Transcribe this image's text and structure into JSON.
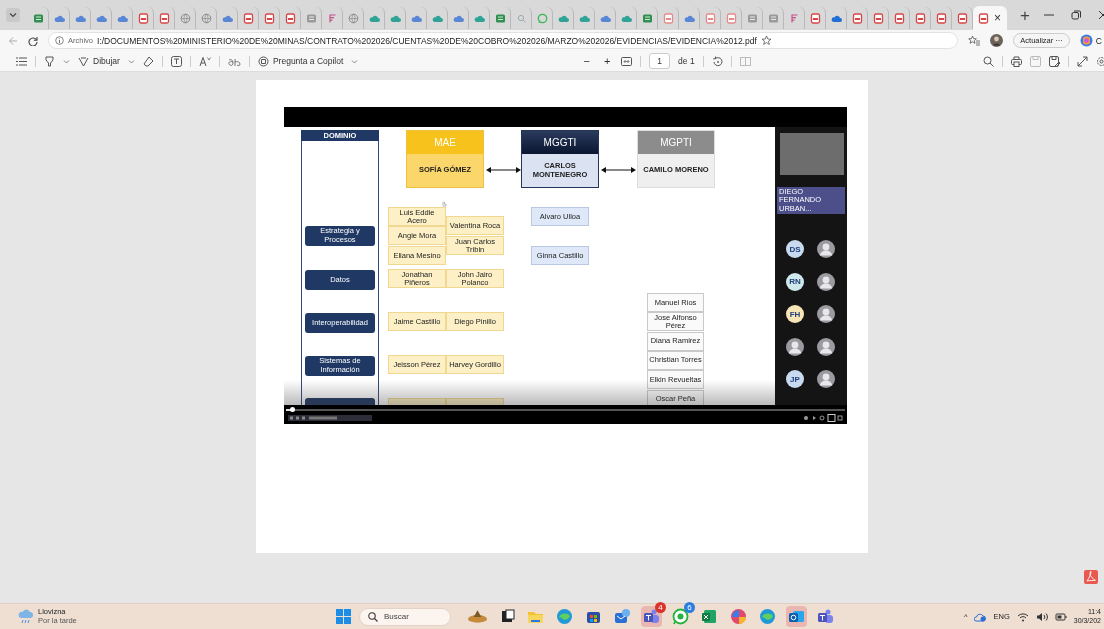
{
  "tab_strip": {
    "tabs": [
      {
        "kind": "sheet",
        "selected": false
      },
      {
        "kind": "cloud",
        "selected": false
      },
      {
        "kind": "cloud",
        "selected": false
      },
      {
        "kind": "cloud",
        "selected": false
      },
      {
        "kind": "cloud",
        "selected": false
      },
      {
        "kind": "pdf",
        "selected": false
      },
      {
        "kind": "pdf",
        "selected": false
      },
      {
        "kind": "globe",
        "selected": false
      },
      {
        "kind": "globe",
        "selected": false
      },
      {
        "kind": "cloud",
        "selected": false
      },
      {
        "kind": "pdf",
        "selected": false
      },
      {
        "kind": "pdf",
        "selected": false
      },
      {
        "kind": "pdf",
        "selected": false
      },
      {
        "kind": "leaf",
        "selected": false
      },
      {
        "kind": "flag",
        "selected": false
      },
      {
        "kind": "globe",
        "selected": false
      },
      {
        "kind": "teal",
        "selected": false
      },
      {
        "kind": "teal",
        "selected": false
      },
      {
        "kind": "cloud",
        "selected": false
      },
      {
        "kind": "teal",
        "selected": false
      },
      {
        "kind": "cloud",
        "selected": false
      },
      {
        "kind": "teal",
        "selected": false
      },
      {
        "kind": "sheet",
        "selected": false
      },
      {
        "kind": "search",
        "selected": false
      },
      {
        "kind": "chat",
        "selected": false
      },
      {
        "kind": "teal",
        "selected": false
      },
      {
        "kind": "teal",
        "selected": false
      },
      {
        "kind": "cloud",
        "selected": false
      },
      {
        "kind": "teal",
        "selected": false
      },
      {
        "kind": "sheet",
        "selected": false
      },
      {
        "kind": "doc",
        "selected": false
      },
      {
        "kind": "cloud",
        "selected": false
      },
      {
        "kind": "doc",
        "selected": false
      },
      {
        "kind": "doc",
        "selected": false
      },
      {
        "kind": "leaf",
        "selected": false
      },
      {
        "kind": "leaf",
        "selected": false
      },
      {
        "kind": "flag",
        "selected": false
      },
      {
        "kind": "pdf",
        "selected": false
      },
      {
        "kind": "onedrive",
        "selected": false
      },
      {
        "kind": "pdf",
        "selected": false
      },
      {
        "kind": "pdf",
        "selected": false
      },
      {
        "kind": "pdf",
        "selected": false
      },
      {
        "kind": "pdf",
        "selected": false
      },
      {
        "kind": "pdf",
        "selected": false
      },
      {
        "kind": "pdf",
        "selected": false
      },
      {
        "kind": "pdf",
        "selected": true
      }
    ],
    "close": "×",
    "new_tab": "+"
  },
  "address_bar": {
    "site_info": "Archivo",
    "url": "I:/DOCUMENTOS%20MINISTERIO%20DE%20MINAS/CONTRATO%202026/CUENTAS%20DE%20COBRO%202026/MARZO%202026/EVIDENCIAS/EVIDENCIA%2012.pdf",
    "update_button": "Actualizar ···",
    "copilot_label": "C"
  },
  "pdf_toolbar": {
    "draw_label": "Dibujar",
    "copilot_prompt": "Pregunta a Copilot",
    "zoom_out": "−",
    "zoom_in": "+",
    "page": "1",
    "page_total": "de 1"
  },
  "slide": {
    "domain_header": "DOMINIO",
    "domains": [
      "Estrategia y Procesos",
      "Datos",
      "Interoperabilidad",
      "Sistemas de Información"
    ],
    "leaders": [
      {
        "kind": "mae",
        "role": "MAE",
        "name": "SOFÍA GÓMEZ"
      },
      {
        "kind": "mggti",
        "role": "MGGTI",
        "name": "CARLOS MONTENEGRO"
      },
      {
        "kind": "mgpti",
        "role": "MGPTI",
        "name": "CAMILO MORENO"
      }
    ],
    "mae_team": [
      "Luis Eddie Acero",
      "Valentina Roca",
      "Angie Mora",
      "Juan Carlos Tribin",
      "Eliana Mesino",
      "Jonathan Piñeros",
      "John Jairo Polanco",
      "Jaime Castillo",
      "Diego Pinillo",
      "Jeisson Pérez",
      "Harvey Gordillo"
    ],
    "mggti_team": [
      "Alvaro Ulloa",
      "Ginna Castillo"
    ],
    "mgpti_team": [
      "Manuel Rios",
      "Jose Alfonso Pérez",
      "Diana Ramirez",
      "Christian Torres",
      "Elkin Revueltas",
      "Oscar Peña"
    ]
  },
  "player": {
    "level": 0.01
  },
  "call_panel": {
    "speaker_name": "DIEGO FERNANDO URBAN...",
    "participants": [
      {
        "kind": "initials",
        "initials": "DS",
        "color": "#c8daf0"
      },
      {
        "kind": "photo"
      },
      {
        "kind": "initials",
        "initials": "RN",
        "color": "#cfe8ec"
      },
      {
        "kind": "photo"
      },
      {
        "kind": "initials",
        "initials": "FH",
        "color": "#f7e6b5"
      },
      {
        "kind": "photo"
      },
      {
        "kind": "photo"
      },
      {
        "kind": "photo"
      },
      {
        "kind": "initials",
        "initials": "JP",
        "color": "#c8daf0"
      },
      {
        "kind": "photo"
      }
    ]
  },
  "taskbar": {
    "weather": {
      "condition": "Llovizna",
      "period": "Por la tarde"
    },
    "search_placeholder": "Buscar",
    "apps": [
      {
        "kind": "widgets",
        "highlighted": false
      },
      {
        "kind": "taskview",
        "highlighted": false
      },
      {
        "kind": "explorer",
        "highlighted": false
      },
      {
        "kind": "edge",
        "highlighted": false
      },
      {
        "kind": "store",
        "highlighted": false
      },
      {
        "kind": "mail",
        "highlighted": false
      },
      {
        "kind": "teams",
        "highlighted": true,
        "badge": "4"
      },
      {
        "kind": "whatsapp",
        "highlighted": false,
        "badge": "6"
      },
      {
        "kind": "excel",
        "highlighted": false
      },
      {
        "kind": "copilot",
        "highlighted": false
      },
      {
        "kind": "edge",
        "highlighted": false
      },
      {
        "kind": "outlook",
        "highlighted": true
      },
      {
        "kind": "teams",
        "highlighted": false
      }
    ],
    "tray_expand": "^",
    "language": "ENG",
    "time": "11:4",
    "date": "30/3/202"
  }
}
